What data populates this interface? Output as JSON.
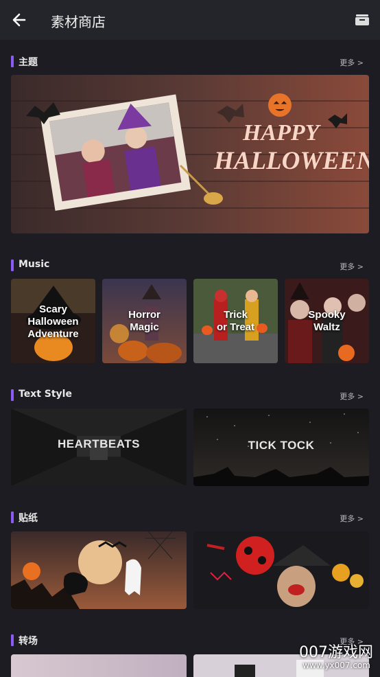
{
  "header": {
    "title": "素材商店",
    "back_icon": "arrow-left-icon",
    "store_icon": "archive-box-icon"
  },
  "sections": [
    {
      "title": "主题",
      "more": "更多 >"
    },
    {
      "title": "Music",
      "more": "更多 >"
    },
    {
      "title": "Text Style",
      "more": "更多 >"
    },
    {
      "title": "贴纸",
      "more": "更多 >"
    },
    {
      "title": "转场",
      "more": "更多 >"
    }
  ],
  "theme_banner": {
    "line1": "HAPPY",
    "line2": "HALLOWEEN"
  },
  "music": [
    {
      "line1": "Scary",
      "line2": "Halloween",
      "line3": "Adventure"
    },
    {
      "line1": "Horror",
      "line2": "Magic"
    },
    {
      "line1": "Trick",
      "line2": "or Treat"
    },
    {
      "line1": "Spooky",
      "line2": "Waltz"
    }
  ],
  "text_styles": [
    {
      "label": "HEARTBEATS"
    },
    {
      "label": "TICK TOCK"
    }
  ],
  "watermark": {
    "text": "007游戏网",
    "url": "www.yx007.com"
  },
  "colors": {
    "accent": "#8a5cf5",
    "background": "#1c1c22",
    "topbar": "#24242b"
  }
}
